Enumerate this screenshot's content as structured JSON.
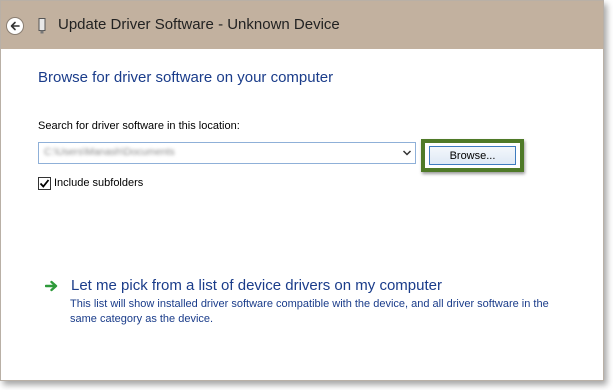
{
  "window": {
    "title": "Update Driver Software - Unknown Device"
  },
  "main": {
    "heading": "Browse for driver software on your computer",
    "search_label": "Search for driver software in this location:",
    "path_value": "C:\\Users\\Manash\\Documents",
    "browse_label": "Browse...",
    "include_subfolders_label": "Include subfolders",
    "include_subfolders_checked": true,
    "pick_title": "Let me pick from a list of device drivers on my computer",
    "pick_description": "This list will show installed driver software compatible with the device, and all driver software in the same category as the device."
  },
  "icons": {
    "back": "back-arrow-icon",
    "device": "device-icon",
    "dropdown": "chevron-down-icon",
    "checkbox": "checkmark-icon",
    "pick": "green-arrow-icon"
  },
  "colors": {
    "titlebar": "#c2b19f",
    "heading_text": "#1a3c8a",
    "highlight_frame": "#4f7a28",
    "pick_arrow": "#2e9a3a"
  }
}
